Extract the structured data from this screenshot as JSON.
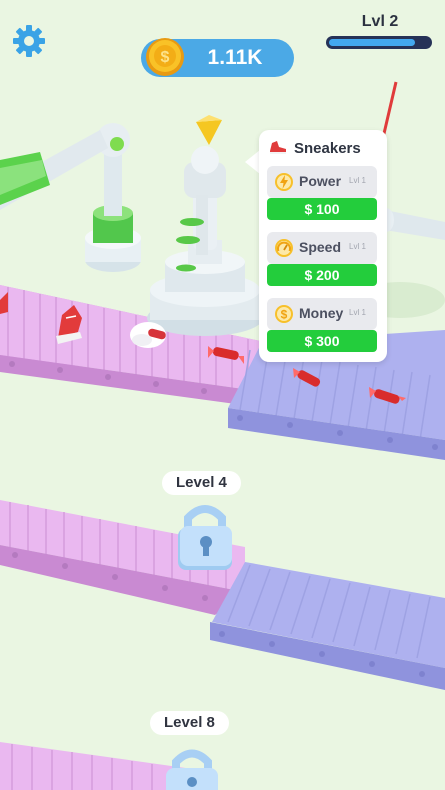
{
  "hud": {
    "currency": "1.11K",
    "level_label": "Lvl 2",
    "level_progress": 0.92
  },
  "popup": {
    "title": "Sneakers",
    "upgrades": [
      {
        "name": "Power",
        "level": "Lvl 1",
        "price": "$ 100",
        "icon": "lightning-icon"
      },
      {
        "name": "Speed",
        "level": "Lvl 1",
        "price": "$ 200",
        "icon": "speedometer-icon"
      },
      {
        "name": "Money",
        "level": "Lvl 1",
        "price": "$ 300",
        "icon": "dollar-coin-icon"
      }
    ]
  },
  "locked_levels": [
    {
      "label": "Level 4"
    },
    {
      "label": "Level 8"
    }
  ],
  "colors": {
    "background": "#eaf6e2",
    "coin_pill": "#4ba9e6",
    "buy_button": "#23cd3c",
    "belt_pink": "#e9b6ee",
    "belt_blue": "#b2b5f2",
    "arrow": "#e03b3b"
  }
}
